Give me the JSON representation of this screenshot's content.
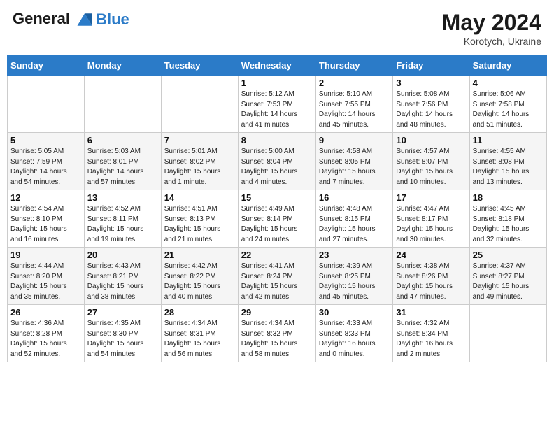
{
  "header": {
    "logo_line1": "General",
    "logo_line2": "Blue",
    "month": "May 2024",
    "location": "Korotych, Ukraine"
  },
  "days_of_week": [
    "Sunday",
    "Monday",
    "Tuesday",
    "Wednesday",
    "Thursday",
    "Friday",
    "Saturday"
  ],
  "weeks": [
    [
      {
        "day": "",
        "info": ""
      },
      {
        "day": "",
        "info": ""
      },
      {
        "day": "",
        "info": ""
      },
      {
        "day": "1",
        "info": "Sunrise: 5:12 AM\nSunset: 7:53 PM\nDaylight: 14 hours\nand 41 minutes."
      },
      {
        "day": "2",
        "info": "Sunrise: 5:10 AM\nSunset: 7:55 PM\nDaylight: 14 hours\nand 45 minutes."
      },
      {
        "day": "3",
        "info": "Sunrise: 5:08 AM\nSunset: 7:56 PM\nDaylight: 14 hours\nand 48 minutes."
      },
      {
        "day": "4",
        "info": "Sunrise: 5:06 AM\nSunset: 7:58 PM\nDaylight: 14 hours\nand 51 minutes."
      }
    ],
    [
      {
        "day": "5",
        "info": "Sunrise: 5:05 AM\nSunset: 7:59 PM\nDaylight: 14 hours\nand 54 minutes."
      },
      {
        "day": "6",
        "info": "Sunrise: 5:03 AM\nSunset: 8:01 PM\nDaylight: 14 hours\nand 57 minutes."
      },
      {
        "day": "7",
        "info": "Sunrise: 5:01 AM\nSunset: 8:02 PM\nDaylight: 15 hours\nand 1 minute."
      },
      {
        "day": "8",
        "info": "Sunrise: 5:00 AM\nSunset: 8:04 PM\nDaylight: 15 hours\nand 4 minutes."
      },
      {
        "day": "9",
        "info": "Sunrise: 4:58 AM\nSunset: 8:05 PM\nDaylight: 15 hours\nand 7 minutes."
      },
      {
        "day": "10",
        "info": "Sunrise: 4:57 AM\nSunset: 8:07 PM\nDaylight: 15 hours\nand 10 minutes."
      },
      {
        "day": "11",
        "info": "Sunrise: 4:55 AM\nSunset: 8:08 PM\nDaylight: 15 hours\nand 13 minutes."
      }
    ],
    [
      {
        "day": "12",
        "info": "Sunrise: 4:54 AM\nSunset: 8:10 PM\nDaylight: 15 hours\nand 16 minutes."
      },
      {
        "day": "13",
        "info": "Sunrise: 4:52 AM\nSunset: 8:11 PM\nDaylight: 15 hours\nand 19 minutes."
      },
      {
        "day": "14",
        "info": "Sunrise: 4:51 AM\nSunset: 8:13 PM\nDaylight: 15 hours\nand 21 minutes."
      },
      {
        "day": "15",
        "info": "Sunrise: 4:49 AM\nSunset: 8:14 PM\nDaylight: 15 hours\nand 24 minutes."
      },
      {
        "day": "16",
        "info": "Sunrise: 4:48 AM\nSunset: 8:15 PM\nDaylight: 15 hours\nand 27 minutes."
      },
      {
        "day": "17",
        "info": "Sunrise: 4:47 AM\nSunset: 8:17 PM\nDaylight: 15 hours\nand 30 minutes."
      },
      {
        "day": "18",
        "info": "Sunrise: 4:45 AM\nSunset: 8:18 PM\nDaylight: 15 hours\nand 32 minutes."
      }
    ],
    [
      {
        "day": "19",
        "info": "Sunrise: 4:44 AM\nSunset: 8:20 PM\nDaylight: 15 hours\nand 35 minutes."
      },
      {
        "day": "20",
        "info": "Sunrise: 4:43 AM\nSunset: 8:21 PM\nDaylight: 15 hours\nand 38 minutes."
      },
      {
        "day": "21",
        "info": "Sunrise: 4:42 AM\nSunset: 8:22 PM\nDaylight: 15 hours\nand 40 minutes."
      },
      {
        "day": "22",
        "info": "Sunrise: 4:41 AM\nSunset: 8:24 PM\nDaylight: 15 hours\nand 42 minutes."
      },
      {
        "day": "23",
        "info": "Sunrise: 4:39 AM\nSunset: 8:25 PM\nDaylight: 15 hours\nand 45 minutes."
      },
      {
        "day": "24",
        "info": "Sunrise: 4:38 AM\nSunset: 8:26 PM\nDaylight: 15 hours\nand 47 minutes."
      },
      {
        "day": "25",
        "info": "Sunrise: 4:37 AM\nSunset: 8:27 PM\nDaylight: 15 hours\nand 49 minutes."
      }
    ],
    [
      {
        "day": "26",
        "info": "Sunrise: 4:36 AM\nSunset: 8:28 PM\nDaylight: 15 hours\nand 52 minutes."
      },
      {
        "day": "27",
        "info": "Sunrise: 4:35 AM\nSunset: 8:30 PM\nDaylight: 15 hours\nand 54 minutes."
      },
      {
        "day": "28",
        "info": "Sunrise: 4:34 AM\nSunset: 8:31 PM\nDaylight: 15 hours\nand 56 minutes."
      },
      {
        "day": "29",
        "info": "Sunrise: 4:34 AM\nSunset: 8:32 PM\nDaylight: 15 hours\nand 58 minutes."
      },
      {
        "day": "30",
        "info": "Sunrise: 4:33 AM\nSunset: 8:33 PM\nDaylight: 16 hours\nand 0 minutes."
      },
      {
        "day": "31",
        "info": "Sunrise: 4:32 AM\nSunset: 8:34 PM\nDaylight: 16 hours\nand 2 minutes."
      },
      {
        "day": "",
        "info": ""
      }
    ]
  ]
}
